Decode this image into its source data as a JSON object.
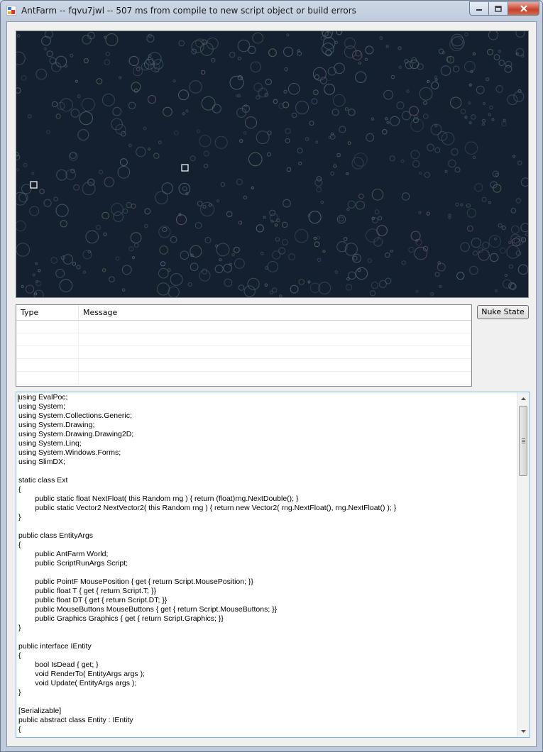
{
  "window": {
    "title": "AntFarm -- fqvu7jwl -- 507 ms from compile to new script object or build errors",
    "minimize_glyph": "–",
    "maximize_glyph": "□",
    "close_glyph": "✕"
  },
  "messages": {
    "columns": [
      "Type",
      "Message"
    ],
    "rows": []
  },
  "toolbar": {
    "nuke_label": "Nuke State"
  },
  "editor": {
    "code": "using EvalPoc;\nusing System;\nusing System.Collections.Generic;\nusing System.Drawing;\nusing System.Drawing.Drawing2D;\nusing System.Linq;\nusing System.Windows.Forms;\nusing SlimDX;\n\nstatic class Ext\n{\n\tpublic static float NextFloat( this Random rng ) { return (float)rng.NextDouble(); }\n\tpublic static Vector2 NextVector2( this Random rng ) { return new Vector2( rng.NextFloat(), rng.NextFloat() ); }\n}\n\npublic class EntityArgs\n{\n\tpublic AntFarm World;\n\tpublic ScriptRunArgs Script;\n\n\tpublic PointF MousePosition { get { return Script.MousePosition; }}\n\tpublic float T { get { return Script.T; }}\n\tpublic float DT { get { return Script.DT; }}\n\tpublic MouseButtons MouseButtons { get { return Script.MouseButtons; }}\n\tpublic Graphics Graphics { get { return Script.Graphics; }}\n}\n\npublic interface IEntity\n{\n\tbool IsDead { get; }\n\tvoid RenderTo( EntityArgs args );\n\tvoid Update( EntityArgs args );\n}\n\n[Serializable]\npublic abstract class Entity : IEntity\n{"
  },
  "colors": {
    "canvas_bg": "#142030",
    "bubble": "#5a6e80",
    "editor_border": "#7eb4ea"
  }
}
